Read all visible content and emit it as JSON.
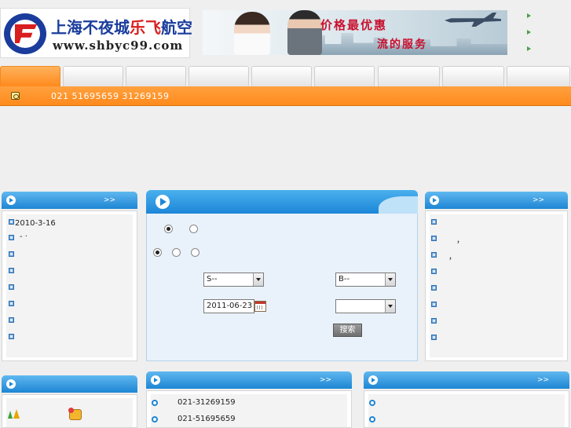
{
  "header": {
    "logo_name_blue": "上海不夜城",
    "logo_name_red": "乐飞",
    "logo_name_tail": "航空",
    "logo_url": "www.shbyc99.com",
    "banner_slogan_1": "价格最优惠",
    "banner_slogan_2": "流的服务"
  },
  "infobar": {
    "phones": "021  51695659  31269159",
    "icon": "phone-icon"
  },
  "news_panel": {
    "more": ">>",
    "items": [
      "2010-3-16",
      "- ·",
      "",
      "",
      "",
      "",
      "",
      ""
    ]
  },
  "search_panel": {
    "from_select": "S--",
    "to_select": "B--",
    "date_value": "2011-06-23",
    "time_select": "",
    "search_button": "搜索"
  },
  "right_panel": {
    "more": ">>",
    "items": [
      "",
      "，",
      "，",
      "",
      "",
      "",
      "",
      ""
    ]
  },
  "bottom_center_panel": {
    "more": ">>",
    "contacts": [
      "021-31269159",
      "021-51695659"
    ]
  },
  "bottom_right_panel": {
    "more": ">>"
  },
  "colors": {
    "nav_orange": "#ff8a1c",
    "panel_blue": "#1d86d4"
  }
}
